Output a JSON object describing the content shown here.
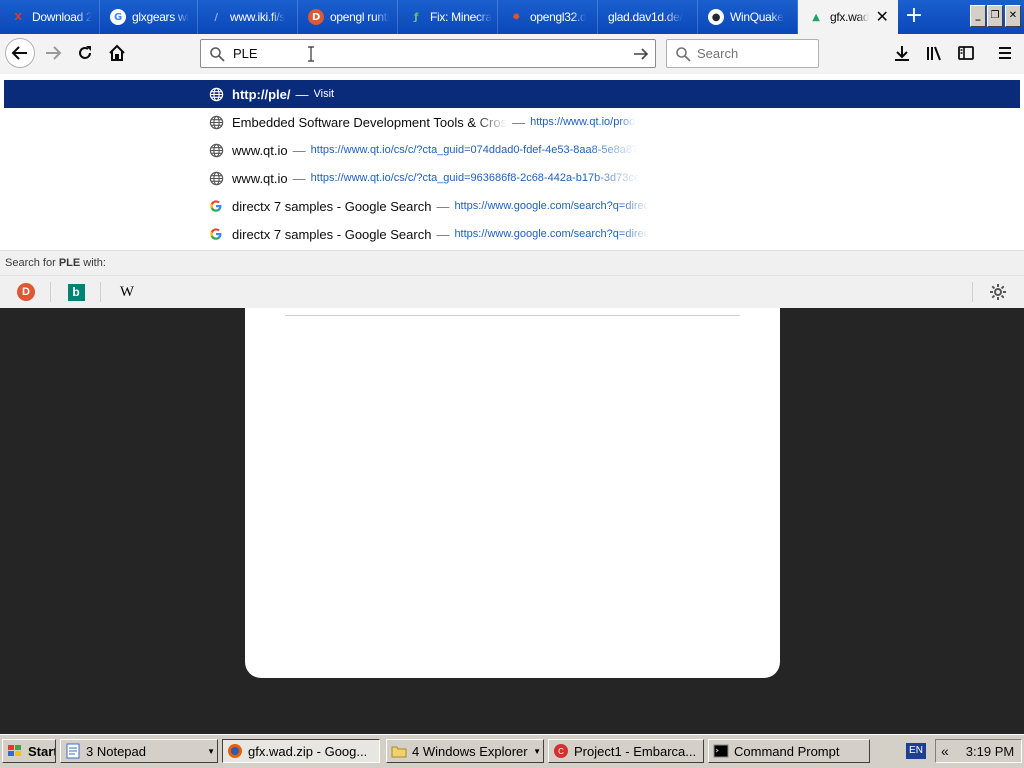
{
  "tabs": [
    {
      "title": "Download 2",
      "favicon": "x-logo-icon",
      "color": "#e03c1a"
    },
    {
      "title": "glxgears wi",
      "favicon": "google-icon",
      "color": "#ffffff"
    },
    {
      "title": "www.iki.fi/s",
      "favicon": "feather-icon",
      "color": "#8fb4ff"
    },
    {
      "title": "opengl runti",
      "favicon": "duckduckgo-icon",
      "color": "#de5833"
    },
    {
      "title": "Fix: Minecra",
      "favicon": "leaf-icon",
      "color": "#6ac26a"
    },
    {
      "title": "opengl32.d",
      "favicon": "gear-icon",
      "color": "#e2562a"
    },
    {
      "title": "glad.dav1d.de/",
      "favicon": "",
      "color": ""
    },
    {
      "title": "WinQuake",
      "favicon": "github-icon",
      "color": "#ffffff"
    },
    {
      "title": "gfx.wad",
      "favicon": "google-drive-icon",
      "color": "#1fa463"
    }
  ],
  "active_tab_index": 8,
  "new_tab_symbol": "+",
  "window_buttons": {
    "minimize": "_",
    "restore": "❐",
    "close": "✕"
  },
  "url_bar": {
    "value": "PLE"
  },
  "search_bar": {
    "placeholder": "Search"
  },
  "suggestions": [
    {
      "type": "globe",
      "title": "http://ple/",
      "sep": "—",
      "url": "Visit",
      "selected": true
    },
    {
      "type": "globe",
      "title": "Embedded Software Development Tools & Cros",
      "sep": "—",
      "url": "https://www.qt.io/prod",
      "selected": false
    },
    {
      "type": "globe",
      "title": "www.qt.io",
      "sep": "—",
      "url": "https://www.qt.io/cs/c/?cta_guid=074ddad0-fdef-4e53-8aa8-5e8a87",
      "selected": false
    },
    {
      "type": "globe",
      "title": "www.qt.io",
      "sep": "—",
      "url": "https://www.qt.io/cs/c/?cta_guid=963686f8-2c68-442a-b17b-3d73ce",
      "selected": false
    },
    {
      "type": "google",
      "title": "directx 7 samples - Google Search",
      "sep": "—",
      "url": "https://www.google.com/search?q=direc",
      "selected": false
    },
    {
      "type": "google",
      "title": "directx 7 samples - Google Search",
      "sep": "—",
      "url": "https://www.google.com/search?q=direc",
      "selected": false
    }
  ],
  "search_with": {
    "prefix": "Search for ",
    "term": "PLE",
    "suffix": " with:"
  },
  "search_engines": [
    {
      "name": "duckduckgo-icon",
      "glyph": "D",
      "color": "#de5833"
    },
    {
      "name": "bing-icon",
      "glyph": "b",
      "color": "#008373"
    },
    {
      "name": "wikipedia-icon",
      "glyph": "W",
      "color": "#000000"
    }
  ],
  "taskbar": {
    "start_label": "Start",
    "items": [
      {
        "label": "3 Notepad",
        "icon": "notepad-icon",
        "has_arrow": true,
        "pressed": false
      },
      {
        "label": "gfx.wad.zip - Goog...",
        "icon": "firefox-icon",
        "has_arrow": false,
        "pressed": true
      },
      {
        "label": "4 Windows Explorer",
        "icon": "folder-icon",
        "has_arrow": true,
        "pressed": false
      },
      {
        "label": "Project1 - Embarca...",
        "icon": "embarcadero-icon",
        "has_arrow": false,
        "pressed": false
      },
      {
        "label": "Command Prompt",
        "icon": "cmd-icon",
        "has_arrow": false,
        "pressed": false
      }
    ],
    "language": "EN",
    "tray_chevron": "«",
    "clock": "3:19 PM"
  }
}
